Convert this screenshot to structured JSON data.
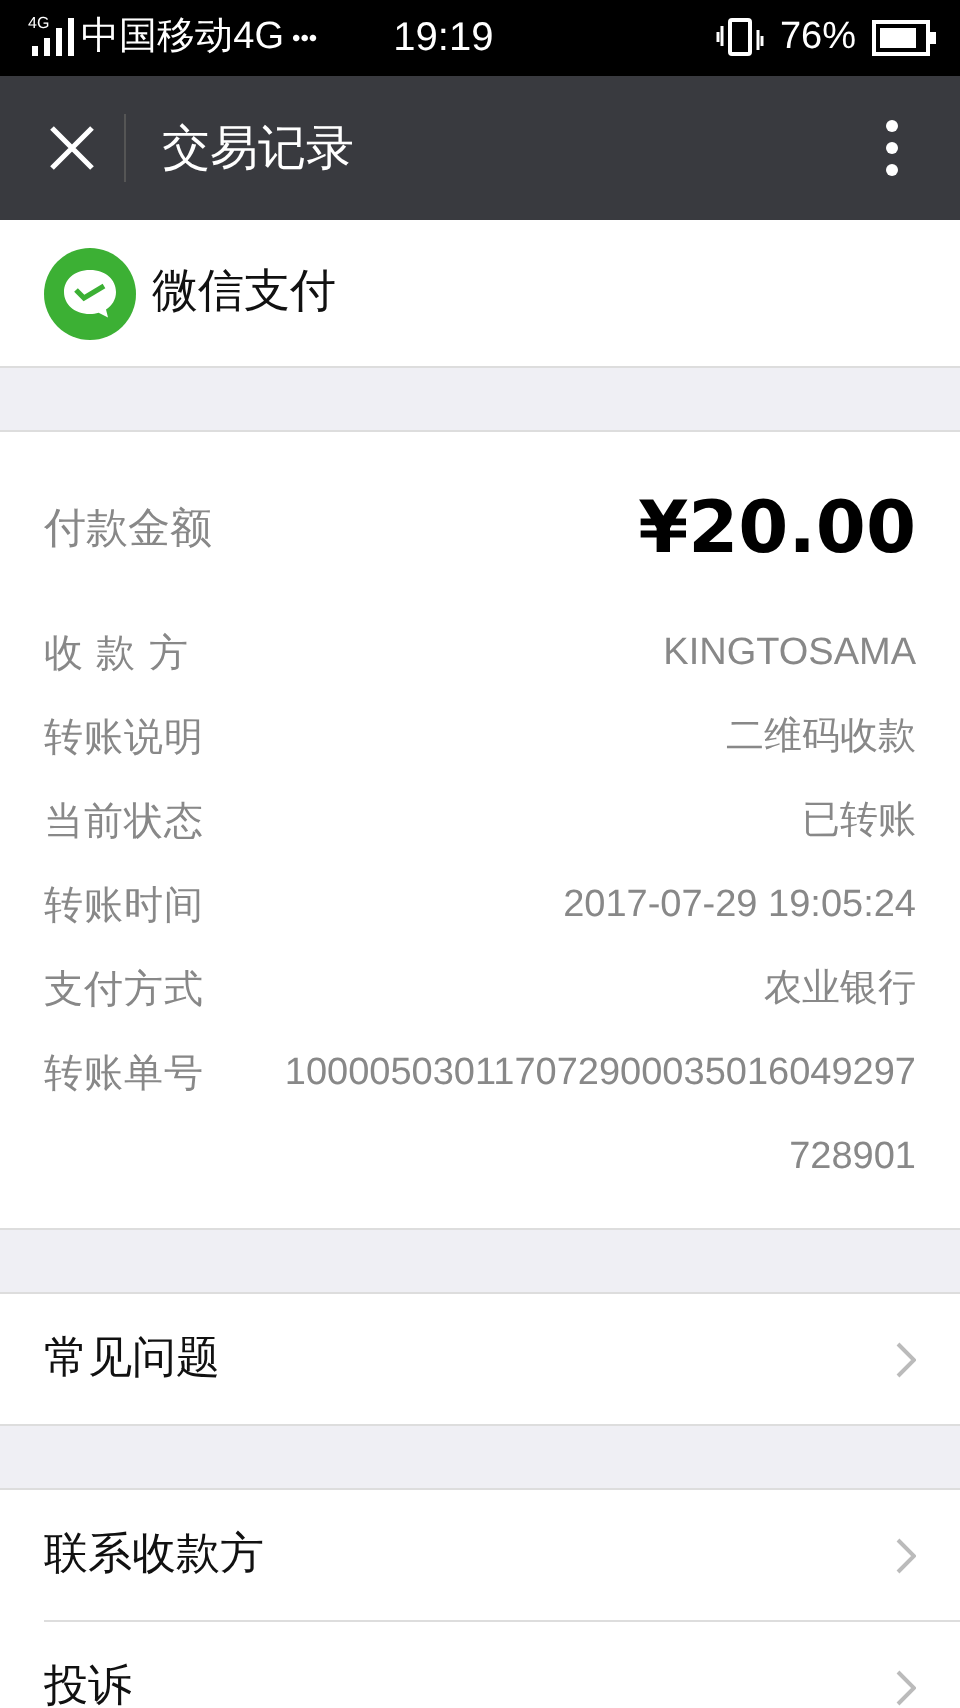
{
  "status_bar": {
    "network_badge": "4G",
    "carrier": "中国移动4G",
    "more": "•••",
    "time": "19:19",
    "battery": "76%"
  },
  "nav": {
    "title": "交易记录"
  },
  "brand": {
    "name": "微信支付"
  },
  "details": [
    {
      "kind": "amount",
      "label": "付款金额",
      "value": "¥20.00"
    },
    {
      "kind": "plain",
      "label": "收 款 方",
      "value": "KINGTOSAMA"
    },
    {
      "kind": "plain",
      "label": "转账说明",
      "value": "二维码收款"
    },
    {
      "kind": "plain",
      "label": "当前状态",
      "value": "已转账"
    },
    {
      "kind": "plain",
      "label": "转账时间",
      "value": "2017-07-29 19:05:24"
    },
    {
      "kind": "plain",
      "label": "支付方式",
      "value": "农业银行"
    },
    {
      "kind": "number",
      "label": "转账单号",
      "value": "100005030117072900035016049297728901"
    }
  ],
  "menu_groups": [
    [
      {
        "label": "常见问题"
      }
    ],
    [
      {
        "label": "联系收款方"
      },
      {
        "label": "投诉"
      }
    ]
  ]
}
